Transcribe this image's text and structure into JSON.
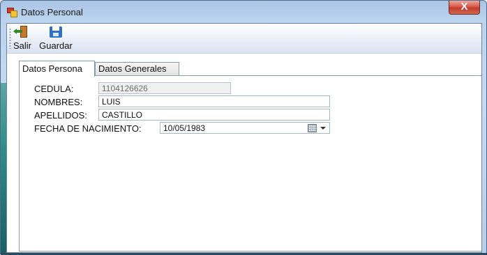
{
  "window": {
    "title": "Datos Personal",
    "close_glyph": "X"
  },
  "toolbar": {
    "salir": {
      "label": "Salir",
      "icon": "exit-door-icon"
    },
    "guardar": {
      "label": "Guardar",
      "icon": "floppy-save-icon"
    }
  },
  "tabs": [
    {
      "label": "Datos Persona",
      "active": true
    },
    {
      "label": "Datos Generales",
      "active": false
    }
  ],
  "form": {
    "cedula": {
      "label": "CEDULA:",
      "value": "1104126626",
      "disabled": true
    },
    "nombres": {
      "label": "NOMBRES:",
      "value": "LUIS"
    },
    "apellidos": {
      "label": "APELLIDOS:",
      "value": "CASTILLO"
    },
    "fecha_nacimiento": {
      "label": "FECHA DE NACIMIENTO:",
      "value": "10/05/1983",
      "icon": "calendar-icon"
    }
  },
  "colors": {
    "frame": "#bcd3ee",
    "close_button": "#c23a2c",
    "disabled_field": "#f0f0f0"
  }
}
